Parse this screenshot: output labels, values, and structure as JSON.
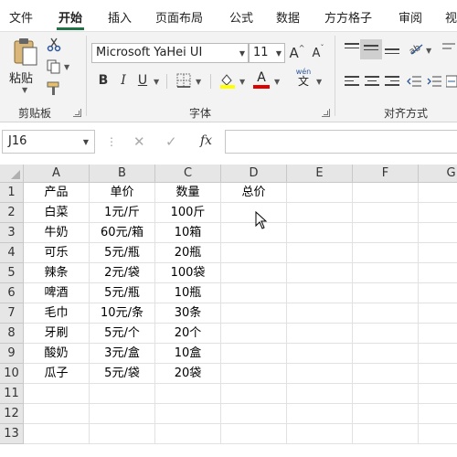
{
  "tabs": [
    "文件",
    "开始",
    "插入",
    "页面布局",
    "公式",
    "数据",
    "方方格子",
    "审阅",
    "视"
  ],
  "active_tab": "开始",
  "accent_color": "#217346",
  "ribbon": {
    "clipboard": {
      "label": "剪贴板",
      "paste_label": "粘贴",
      "icons": [
        "paste-icon",
        "cut-icon",
        "copy-icon",
        "format-painter-icon"
      ]
    },
    "font": {
      "label": "字体",
      "font_name": "Microsoft YaHei UI",
      "font_size": "11",
      "increase_label": "A",
      "decrease_label": "A",
      "bold": "B",
      "italic": "I",
      "underline": "U",
      "font_color_label": "A",
      "phonetic_label": "wén",
      "phonetic_char": "文"
    },
    "alignment": {
      "label": "对齐方式"
    }
  },
  "formula_bar": {
    "name_box": "J16",
    "fx": "fx",
    "cancel": "✕",
    "enter": "✓",
    "value": ""
  },
  "sheet": {
    "columns": [
      "A",
      "B",
      "C",
      "D",
      "E",
      "F",
      "G"
    ],
    "rows": [
      "1",
      "2",
      "3",
      "4",
      "5",
      "6",
      "7",
      "8",
      "9",
      "10",
      "11",
      "12",
      "13"
    ],
    "cells": [
      [
        "产品",
        "单价",
        "数量",
        "总价"
      ],
      [
        "白菜",
        "1元/斤",
        "100斤",
        ""
      ],
      [
        "牛奶",
        "60元/箱",
        "10箱",
        ""
      ],
      [
        "可乐",
        "5元/瓶",
        "20瓶",
        ""
      ],
      [
        "辣条",
        "2元/袋",
        "100袋",
        ""
      ],
      [
        "啤酒",
        "5元/瓶",
        "10瓶",
        ""
      ],
      [
        "毛巾",
        "10元/条",
        "30条",
        ""
      ],
      [
        "牙刷",
        "5元/个",
        "20个",
        ""
      ],
      [
        "酸奶",
        "3元/盒",
        "10盒",
        ""
      ],
      [
        "瓜子",
        "5元/袋",
        "20袋",
        ""
      ]
    ]
  }
}
